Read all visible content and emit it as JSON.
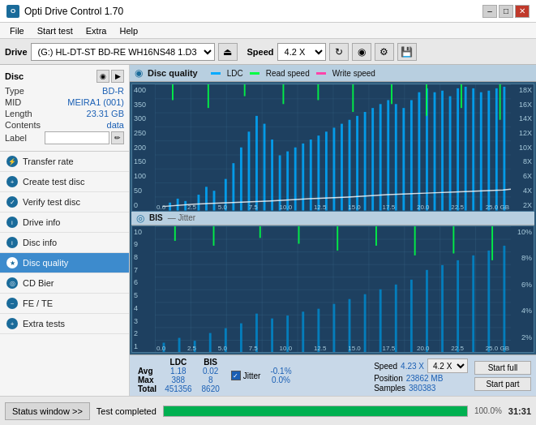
{
  "app": {
    "title": "Opti Drive Control 1.70",
    "icon_text": "O"
  },
  "titlebar": {
    "minimize_label": "–",
    "maximize_label": "□",
    "close_label": "✕"
  },
  "menubar": {
    "items": [
      "File",
      "Start test",
      "Extra",
      "Help"
    ]
  },
  "drivebar": {
    "label": "Drive",
    "drive_value": "(G:)  HL-DT-ST BD-RE  WH16NS48 1.D3",
    "speed_label": "Speed",
    "speed_value": "4.2 X"
  },
  "disc": {
    "title": "Disc",
    "type_label": "Type",
    "type_value": "BD-R",
    "mid_label": "MID",
    "mid_value": "MEIRA1 (001)",
    "length_label": "Length",
    "length_value": "23.31 GB",
    "contents_label": "Contents",
    "contents_value": "data",
    "label_label": "Label",
    "label_value": ""
  },
  "sidebar": {
    "items": [
      {
        "id": "transfer-rate",
        "label": "Transfer rate",
        "active": false
      },
      {
        "id": "create-test-disc",
        "label": "Create test disc",
        "active": false
      },
      {
        "id": "verify-test-disc",
        "label": "Verify test disc",
        "active": false
      },
      {
        "id": "drive-info",
        "label": "Drive info",
        "active": false
      },
      {
        "id": "disc-info",
        "label": "Disc info",
        "active": false
      },
      {
        "id": "disc-quality",
        "label": "Disc quality",
        "active": true
      },
      {
        "id": "cd-bier",
        "label": "CD Bier",
        "active": false
      },
      {
        "id": "fe-te",
        "label": "FE / TE",
        "active": false
      },
      {
        "id": "extra-tests",
        "label": "Extra tests",
        "active": false
      }
    ]
  },
  "content": {
    "title": "Disc quality",
    "legend": {
      "ldc_label": "LDC",
      "read_speed_label": "Read speed",
      "write_speed_label": "Write speed",
      "bis_label": "BIS",
      "jitter_label": "Jitter"
    }
  },
  "stats": {
    "headers": [
      "",
      "LDC",
      "BIS",
      "",
      "Jitter",
      "Speed",
      ""
    ],
    "avg_label": "Avg",
    "avg_ldc": "1.18",
    "avg_bis": "0.02",
    "avg_jitter": "-0.1%",
    "max_label": "Max",
    "max_ldc": "388",
    "max_bis": "8",
    "max_jitter": "0.0%",
    "total_label": "Total",
    "total_ldc": "451356",
    "total_bis": "8620",
    "speed_value": "4.23 X",
    "speed_select": "4.2 X",
    "position_label": "Position",
    "position_value": "23862 MB",
    "samples_label": "Samples",
    "samples_value": "380383",
    "start_full_label": "Start full",
    "start_part_label": "Start part"
  },
  "statusbar": {
    "status_window_label": "Status window >>",
    "status_text": "Test completed",
    "progress_percent": 100,
    "time": "31:31"
  },
  "chart1": {
    "y_max": 400,
    "y_labels": [
      "400",
      "350",
      "300",
      "250",
      "200",
      "150",
      "100",
      "50",
      "0"
    ],
    "y_right_labels": [
      "18X",
      "16X",
      "14X",
      "12X",
      "10X",
      "8X",
      "6X",
      "4X",
      "2X"
    ],
    "x_labels": [
      "0.0",
      "2.5",
      "5.0",
      "7.5",
      "10.0",
      "12.5",
      "15.0",
      "17.5",
      "20.0",
      "22.5",
      "25.0 GB"
    ]
  },
  "chart2": {
    "y_max": 10,
    "y_labels": [
      "10",
      "9",
      "8",
      "7",
      "6",
      "5",
      "4",
      "3",
      "2",
      "1"
    ],
    "y_right_labels": [
      "10%",
      "8%",
      "6%",
      "4%",
      "2%"
    ],
    "x_labels": [
      "0.0",
      "2.5",
      "5.0",
      "7.5",
      "10.0",
      "12.5",
      "15.0",
      "17.5",
      "20.0",
      "22.5",
      "25.0 GB"
    ]
  }
}
